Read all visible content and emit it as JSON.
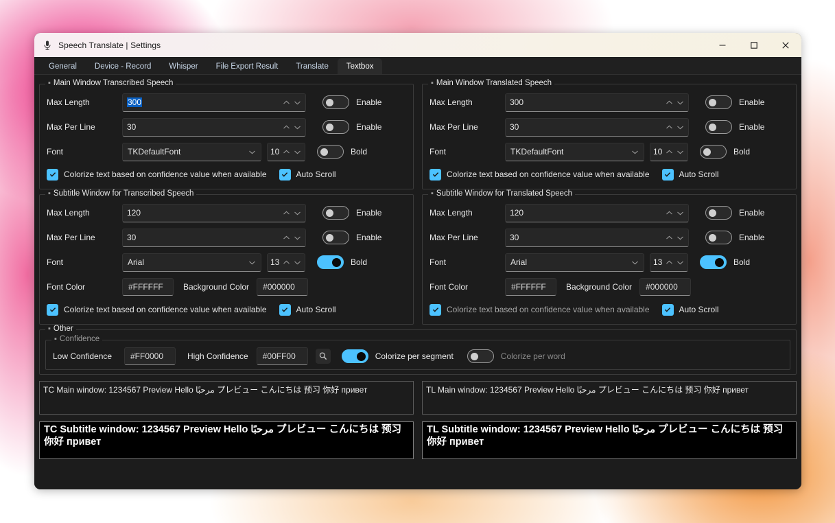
{
  "window": {
    "title": "Speech Translate | Settings",
    "app_icon": "microphone-icon",
    "minimize": "─",
    "maximize": "☐",
    "close": "✕"
  },
  "tabs": [
    {
      "label": "General",
      "active": false
    },
    {
      "label": "Device - Record",
      "active": false
    },
    {
      "label": "Whisper",
      "active": false
    },
    {
      "label": "File Export Result",
      "active": false
    },
    {
      "label": "Translate",
      "active": false
    },
    {
      "label": "Textbox",
      "active": true
    }
  ],
  "groups": {
    "main_transcribed": {
      "title": "Main Window Transcribed Speech",
      "max_length": {
        "label": "Max Length",
        "value": "300",
        "selected": true,
        "toggle_label": "Enable",
        "toggle_on": false
      },
      "max_per_line": {
        "label": "Max Per Line",
        "value": "30",
        "toggle_label": "Enable",
        "toggle_on": false
      },
      "font": {
        "label": "Font",
        "value": "TKDefaultFont",
        "size": "10",
        "toggle_label": "Bold",
        "toggle_on": false
      },
      "colorize": {
        "label": "Colorize text based on confidence value when available",
        "checked": true
      },
      "autoscroll": {
        "label": "Auto Scroll",
        "checked": true
      }
    },
    "main_translated": {
      "title": "Main Window Translated Speech",
      "max_length": {
        "label": "Max Length",
        "value": "300",
        "selected": false,
        "toggle_label": "Enable",
        "toggle_on": false
      },
      "max_per_line": {
        "label": "Max Per Line",
        "value": "30",
        "toggle_label": "Enable",
        "toggle_on": false
      },
      "font": {
        "label": "Font",
        "value": "TKDefaultFont",
        "size": "10",
        "toggle_label": "Bold",
        "toggle_on": false
      },
      "colorize": {
        "label": "Colorize text based on confidence value when available",
        "checked": true
      },
      "autoscroll": {
        "label": "Auto Scroll",
        "checked": true
      }
    },
    "subtitle_transcribed": {
      "title": "Subtitle Window for Transcribed Speech",
      "max_length": {
        "label": "Max Length",
        "value": "120",
        "toggle_label": "Enable",
        "toggle_on": false
      },
      "max_per_line": {
        "label": "Max Per Line",
        "value": "30",
        "toggle_label": "Enable",
        "toggle_on": false
      },
      "font": {
        "label": "Font",
        "value": "Arial",
        "size": "13",
        "toggle_label": "Bold",
        "toggle_on": true
      },
      "font_color": {
        "label": "Font Color",
        "value": "#FFFFFF"
      },
      "background_color": {
        "label": "Background Color",
        "value": "#000000"
      },
      "colorize": {
        "label": "Colorize text based on confidence value when available",
        "checked": true
      },
      "autoscroll": {
        "label": "Auto Scroll",
        "checked": true
      }
    },
    "subtitle_translated": {
      "title": "Subtitle Window for Translated Speech",
      "max_length": {
        "label": "Max Length",
        "value": "120",
        "toggle_label": "Enable",
        "toggle_on": false
      },
      "max_per_line": {
        "label": "Max Per Line",
        "value": "30",
        "toggle_label": "Enable",
        "toggle_on": false
      },
      "font": {
        "label": "Font",
        "value": "Arial",
        "size": "13",
        "toggle_label": "Bold",
        "toggle_on": true
      },
      "font_color": {
        "label": "Font Color",
        "value": "#FFFFFF"
      },
      "background_color": {
        "label": "Background Color",
        "value": "#000000"
      },
      "colorize": {
        "label": "Colorize text based on confidence value when available",
        "checked": true
      },
      "autoscroll": {
        "label": "Auto Scroll",
        "checked": true
      }
    },
    "other": {
      "title": "Other",
      "confidence": {
        "title": "Confidence",
        "low_label": "Low Confidence",
        "low_value": "#FF0000",
        "high_label": "High Confidence",
        "high_value": "#00FF00",
        "preview_icon": "magnifier-icon",
        "per_segment_label": "Colorize per segment",
        "per_segment_on": true,
        "per_word_label": "Colorize per word",
        "per_word_on": false
      }
    }
  },
  "previews": {
    "tc_main": "TC Main window: 1234567 Preview Hello مرحبًا プレビュー こんにちは 预习 你好 привет",
    "tl_main": "TL Main window: 1234567 Preview Hello مرحبًا プレビュー こんにちは 预习 你好 привет",
    "tc_sub": "TC Subtitle window: 1234567 Preview Hello مرحبًا プレビュー こんにちは 预习 你好 привет",
    "tl_sub": "TL Subtitle window: 1234567 Preview Hello مرحبًا プレビュー こんにちは 预习 你好 привет"
  },
  "colors": {
    "accent": "#4CC2FF",
    "window_bg": "#1C1C1C",
    "selection": "#0A60C2",
    "glow_start": "#E91E78",
    "glow_end": "#F39237"
  }
}
